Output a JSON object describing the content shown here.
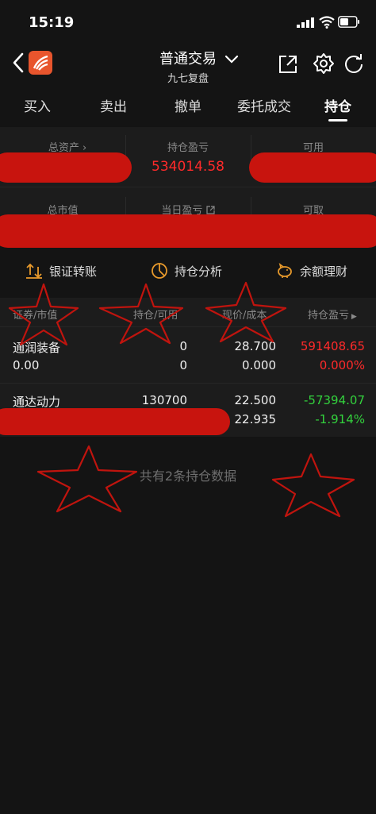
{
  "status": {
    "time": "15:19"
  },
  "header": {
    "title": "普通交易",
    "subtitle": "九七复盘"
  },
  "tabs": [
    "买入",
    "卖出",
    "撤单",
    "委托成交",
    "持仓"
  ],
  "summary": {
    "total_assets_label": "总资产",
    "pnl_label": "持仓盈亏",
    "pnl_value": "534014.58",
    "available_label": "可用",
    "market_value_label": "总市值",
    "daily_pnl_label": "当日盈亏",
    "withdrawable_label": "可取"
  },
  "actions": {
    "transfer": "银证转账",
    "analysis": "持仓分析",
    "wealth": "余额理财"
  },
  "table": {
    "headers": [
      "证券/市值",
      "持仓/可用",
      "现价/成本",
      "持仓盈亏"
    ],
    "rows": [
      {
        "name": "通润装备",
        "market_value": "0.00",
        "position": "0",
        "available": "0",
        "price": "28.700",
        "cost": "0.000",
        "pnl": "591408.65",
        "pnl_pct": "0.000%"
      },
      {
        "name": "通达动力",
        "position": "130700",
        "price": "22.500",
        "cost": "22.935",
        "pnl": "-57394.07",
        "pnl_pct": "-1.914%"
      }
    ]
  },
  "footer_note": "共有2条持仓数据",
  "colors": {
    "accent": "#e8552d",
    "profit": "#ff2a2a",
    "loss": "#33d23d",
    "redaction": "#c8140e"
  }
}
